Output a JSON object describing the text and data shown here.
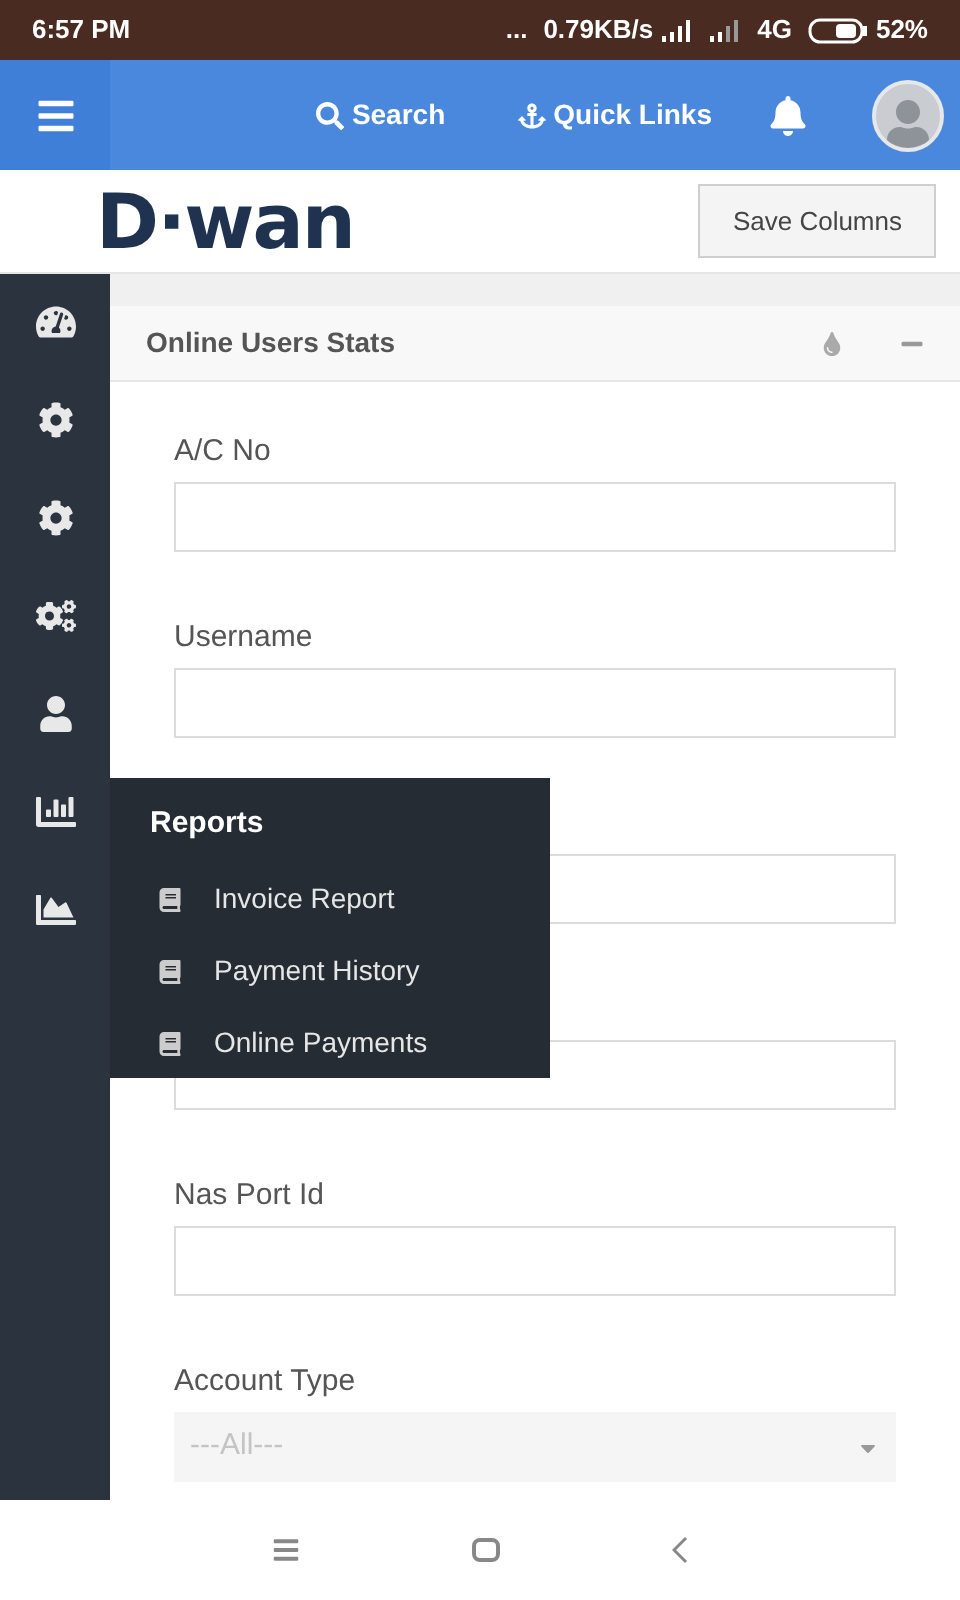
{
  "status_bar": {
    "time": "6:57 PM",
    "dots": "...",
    "speed": "0.79KB/s",
    "network": "4G",
    "battery": "52%"
  },
  "header": {
    "search": "Search",
    "quick_links": "Quick Links"
  },
  "logo": "D·wan",
  "save_button": "Save Columns",
  "sidebar": {
    "items": [
      {
        "kind": "dashboard"
      },
      {
        "kind": "gear"
      },
      {
        "kind": "gear"
      },
      {
        "kind": "gears"
      },
      {
        "kind": "user"
      },
      {
        "kind": "bar"
      },
      {
        "kind": "area"
      }
    ]
  },
  "flyout": {
    "title": "Reports",
    "items": [
      "Invoice Report",
      "Payment History",
      "Online Payments"
    ]
  },
  "panel": {
    "title": "Online Users Stats"
  },
  "fields": [
    {
      "kind": "input",
      "label": "A/C No"
    },
    {
      "kind": "input",
      "label": "Username"
    },
    {
      "kind": "input"
    },
    {
      "kind": "input"
    },
    {
      "kind": "input",
      "label": "Nas Port Id"
    },
    {
      "kind": "select",
      "label": "Account Type",
      "value": "---All---"
    }
  ]
}
